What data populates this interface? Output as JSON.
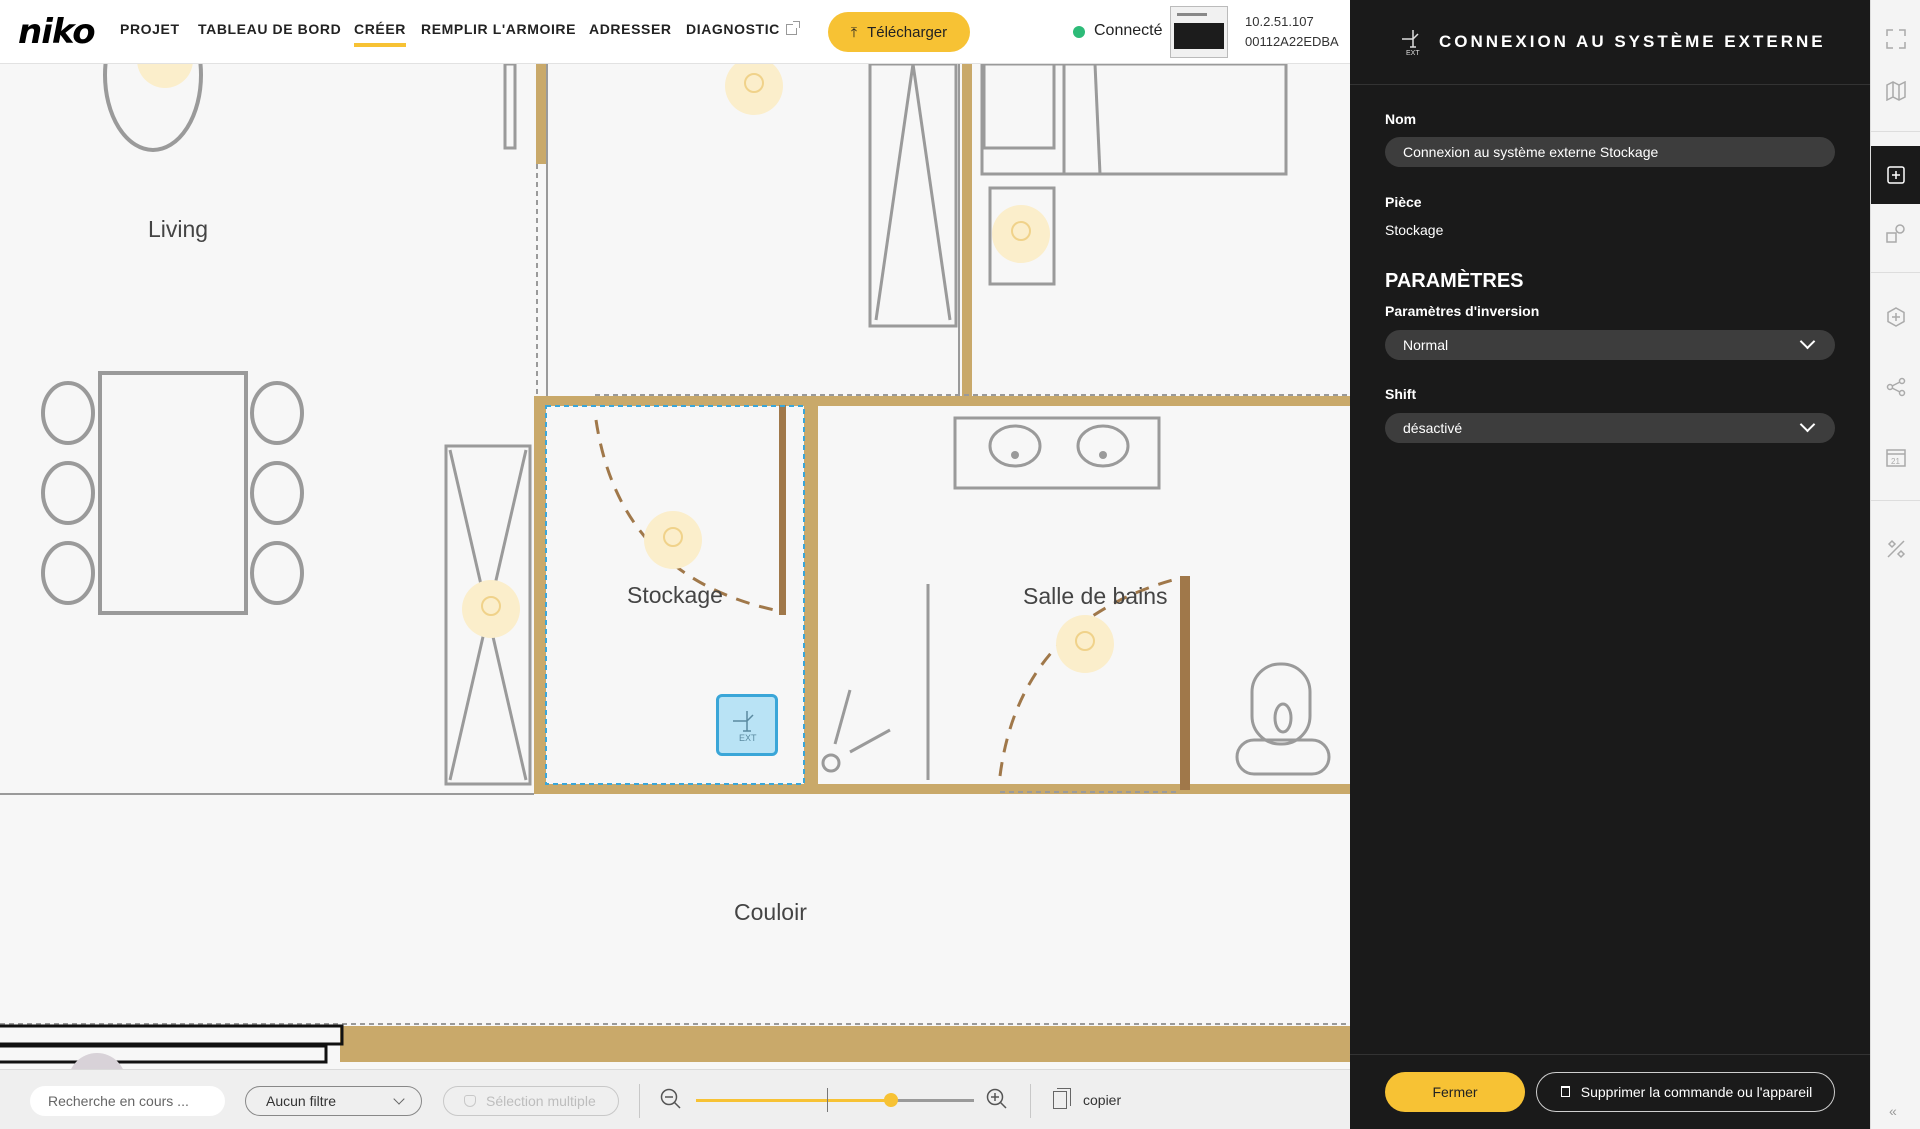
{
  "app": {
    "logo": "niko",
    "nav": [
      {
        "label": "PROJET"
      },
      {
        "label": "TABLEAU DE BORD"
      },
      {
        "label": "CRÉER",
        "active": true
      },
      {
        "label": "REMPLIR L'ARMOIRE"
      },
      {
        "label": "ADRESSER"
      },
      {
        "label": "DIAGNOSTIC",
        "external": true
      }
    ],
    "download_label": "Télécharger",
    "connection": {
      "label": "Connecté",
      "status_color": "#2dbb78"
    },
    "device": {
      "ip": "10.2.51.107",
      "id": "00112A22EDBA"
    },
    "accent_color": "#f7c234"
  },
  "floorplan": {
    "rooms": {
      "living": "Living",
      "stockage": "Stockage",
      "salle": "Salle de bains",
      "couloir": "Couloir"
    },
    "selected_device": {
      "icon": "external-system-icon",
      "caption": "EXT"
    }
  },
  "toolbar": {
    "search_placeholder": "Recherche en cours ...",
    "filter_value": "Aucun filtre",
    "multi_select_label": "Sélection multiple",
    "zoom_level": 0.7,
    "copy_label": "copier"
  },
  "panel": {
    "title": "CONNEXION AU SYSTÈME EXTERNE",
    "name_label": "Nom",
    "name_value": "Connexion au système externe Stockage",
    "piece_label": "Pièce",
    "piece_value": "Stockage",
    "params_heading": "PARAMÈTRES",
    "inversion_label": "Paramètres d'inversion",
    "inversion_value": "Normal",
    "shift_label": "Shift",
    "shift_value": "désactivé",
    "close_label": "Fermer",
    "delete_label": "Supprimer la commande ou l'appareil"
  },
  "rail": {
    "icons": [
      "fullscreen-icon",
      "map-icon",
      "add-device-icon",
      "shapes-icon",
      "hexagon-plus-icon",
      "share-icon",
      "calendar-icon",
      "tools-icon"
    ],
    "calendar_day": "21",
    "collapse": "«"
  }
}
